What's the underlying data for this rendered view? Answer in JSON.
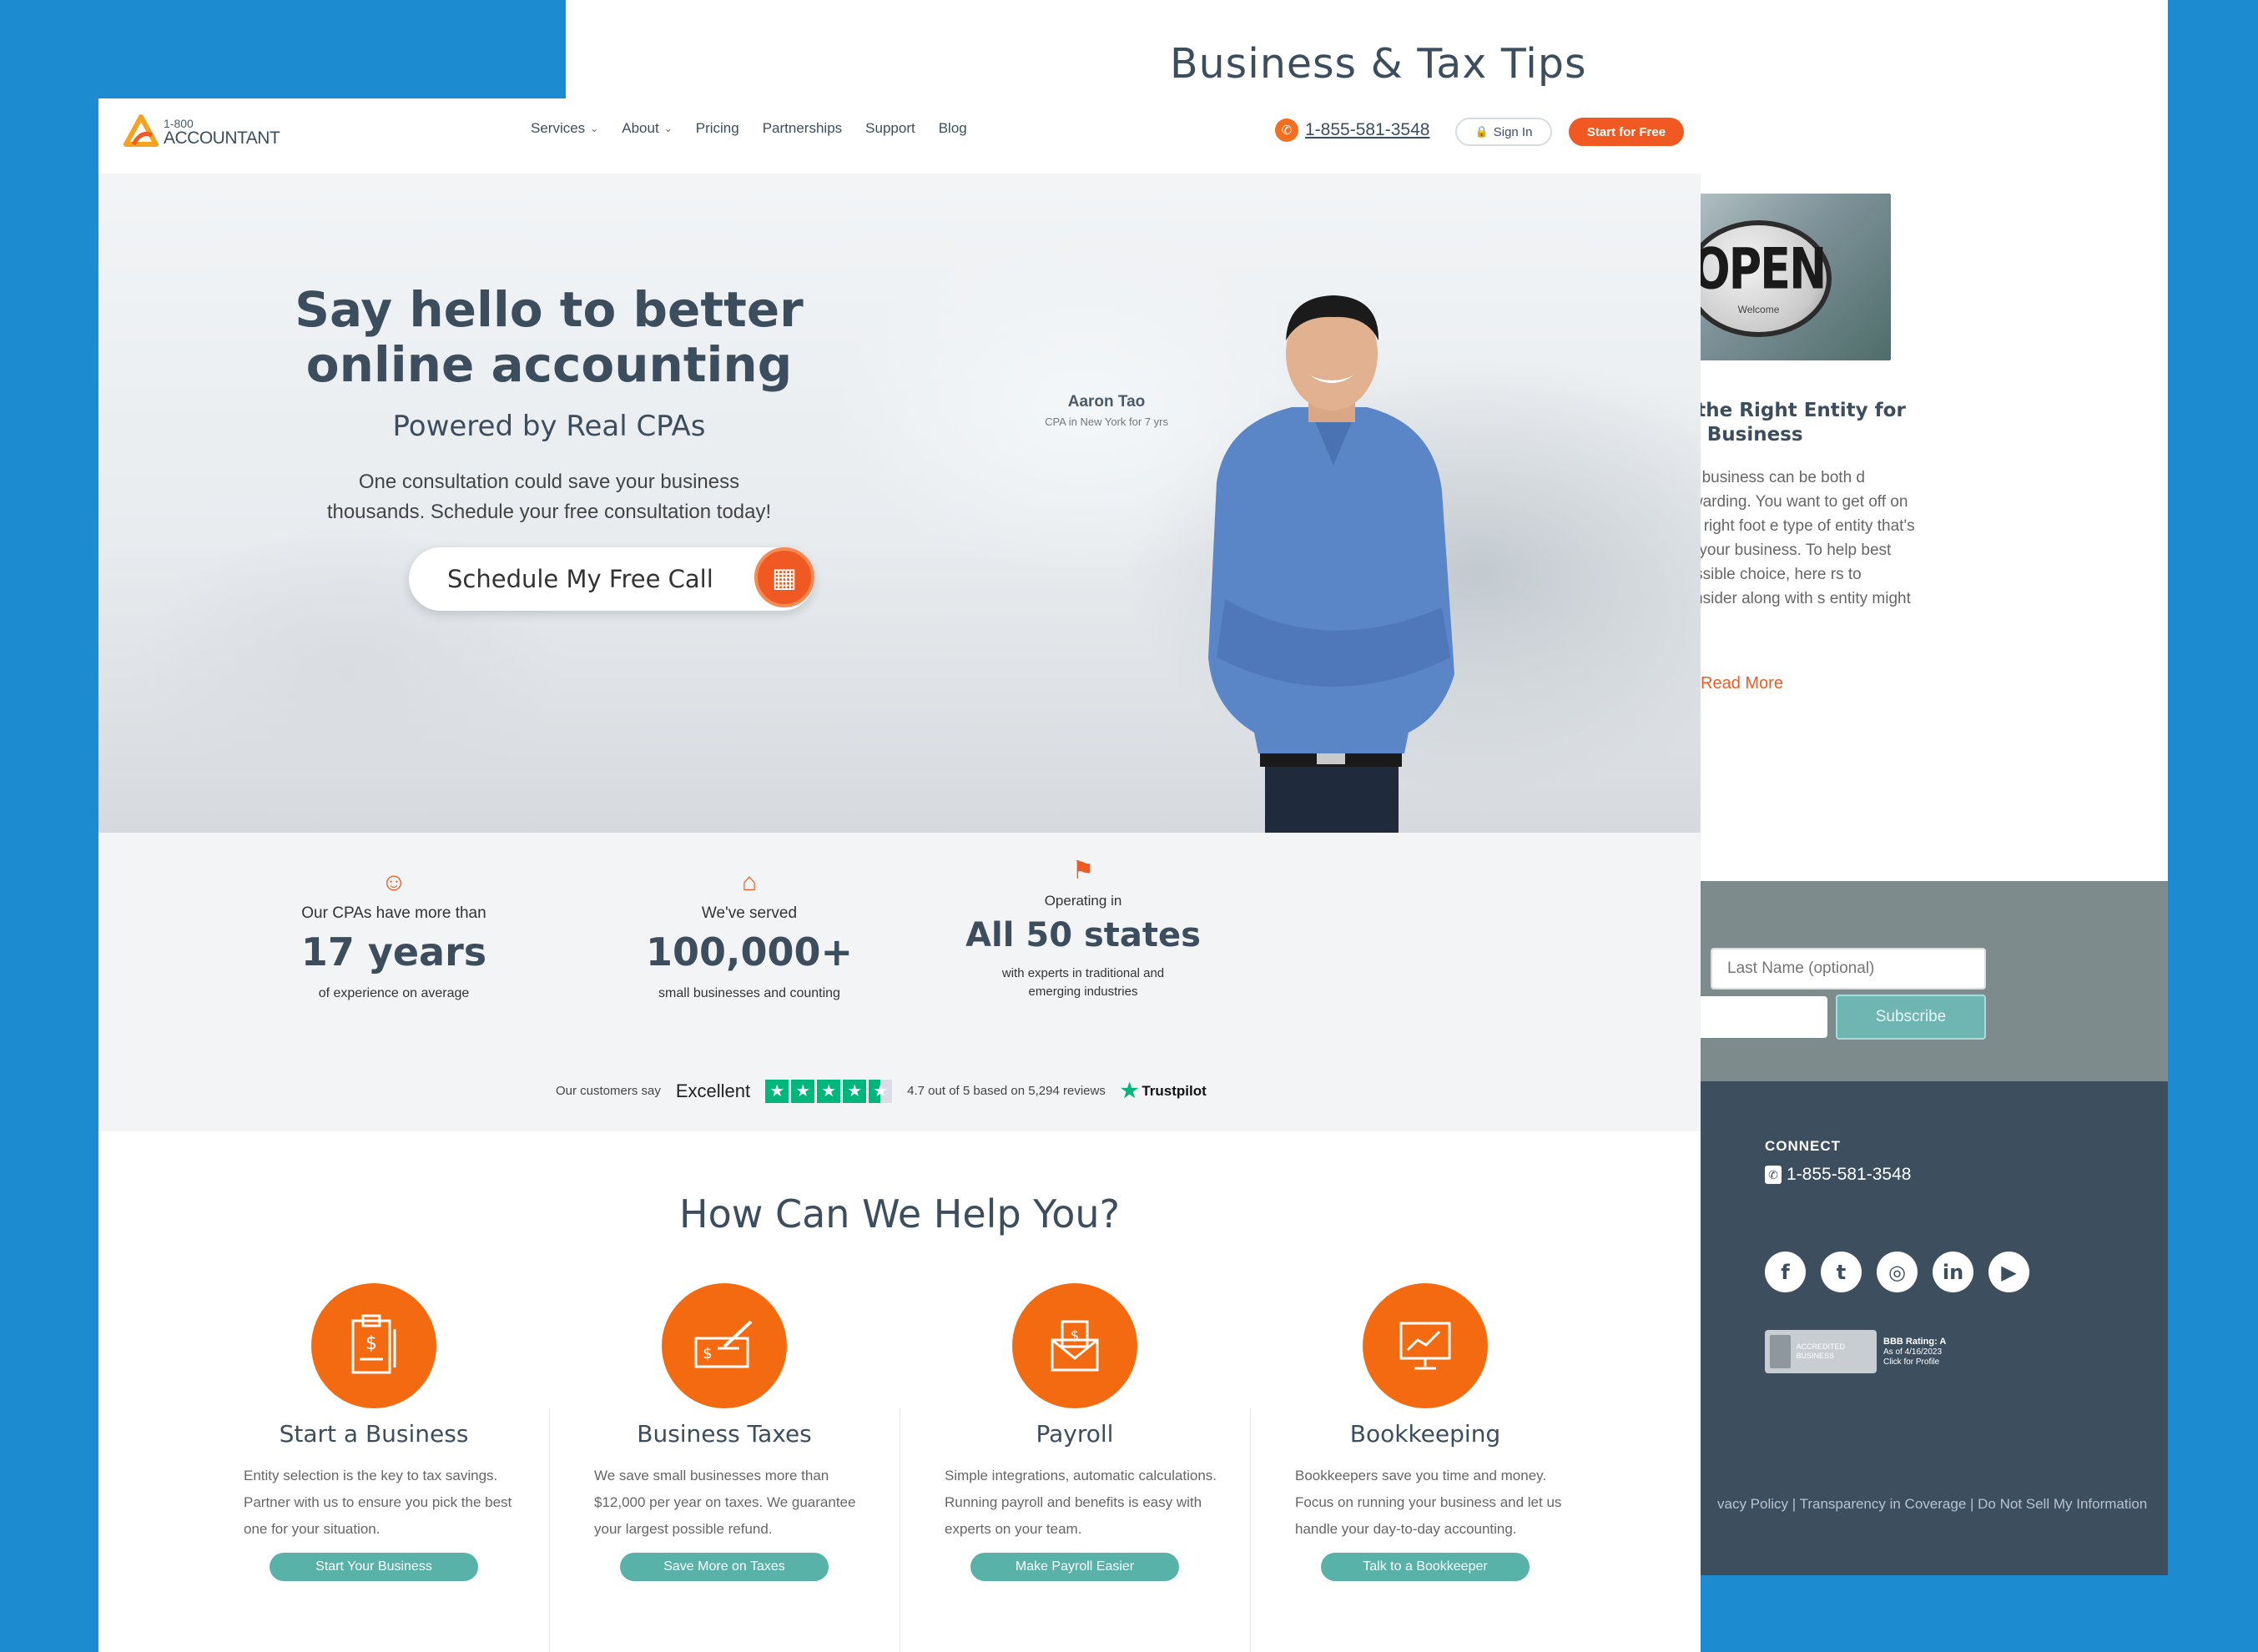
{
  "background_card": {
    "title": "Business & Tax Tips",
    "blog": {
      "image_sign_text": "OPEN",
      "image_sign_subtext": "Welcome",
      "title": "k the Right Entity for ur Business",
      "excerpt": "wn business can be both d rewarding. You want to get off on the right foot e type of entity that's nd your business. To help best possible choice, here rs to consider along with s entity might [...]",
      "read_more": "Read More"
    },
    "newsletter": {
      "last_name_placeholder": "Last Name (optional)",
      "subscribe_label": "Subscribe"
    },
    "footer": {
      "connect_label": "CONNECT",
      "phone": "1-855-581-3548",
      "social_icons": [
        "facebook-icon",
        "twitter-icon",
        "instagram-icon",
        "linkedin-icon",
        "youtube-icon"
      ],
      "social_glyphs": [
        "f",
        "t",
        "◎",
        "in",
        "▶"
      ],
      "bbb_seal": "ACCREDITED BUSINESS",
      "bbb_rating": "BBB Rating: A",
      "bbb_date": "As of 4/16/2023",
      "bbb_click": "Click for Profile",
      "links": "vacy Policy | Transparency in Coverage | Do Not Sell My Information"
    }
  },
  "nav": {
    "logo_top": "1-800",
    "logo_bottom": "ACCOUNTANT",
    "menu": [
      {
        "label": "Services",
        "has_dropdown": true
      },
      {
        "label": "About",
        "has_dropdown": true
      },
      {
        "label": "Pricing",
        "has_dropdown": false
      },
      {
        "label": "Partnerships",
        "has_dropdown": false
      },
      {
        "label": "Support",
        "has_dropdown": false
      },
      {
        "label": "Blog",
        "has_dropdown": false
      }
    ],
    "phone": "1-855-581-3548",
    "sign_in": "Sign In",
    "start_free": "Start for Free"
  },
  "hero": {
    "headline": "Say hello to better online accounting",
    "subheadline": "Powered by Real CPAs",
    "body": "One consultation could save your business thousands. Schedule your free consultation today!",
    "cta": "Schedule My Free Call",
    "person_name": "Aaron Tao",
    "person_role": "CPA in New York for 7 yrs"
  },
  "stats": [
    {
      "icon": "face-icon",
      "lead": "Our CPAs have more than",
      "big": "17 years",
      "tail": "of experience on average"
    },
    {
      "icon": "storefront-icon",
      "lead": "We've served",
      "big": "100,000+",
      "tail": "small businesses and counting"
    },
    {
      "icon": "flag-icon",
      "lead": "Operating in",
      "big": "All 50 states",
      "tail": "with experts in traditional and emerging industries"
    }
  ],
  "trustpilot": {
    "say": "Our customers say",
    "rating_word": "Excellent",
    "stars": 4.5,
    "summary": "4.7 out of 5 based on 5,294 reviews",
    "brand": "Trustpilot"
  },
  "help": {
    "title": "How Can We Help You?",
    "services": [
      {
        "icon": "clipboard-icon",
        "title": "Start a Business",
        "text": "Entity selection is the key to tax savings. Partner with us to ensure you pick the best one for your situation.",
        "button": "Start Your Business"
      },
      {
        "icon": "check-signing-icon",
        "title": "Business Taxes",
        "text": "We save small businesses more than $12,000 per year on taxes. We guarantee your largest possible refund.",
        "button": "Save More on Taxes"
      },
      {
        "icon": "envelope-icon",
        "title": "Payroll",
        "text": "Simple integrations, automatic calculations. Running payroll and benefits is easy with experts on your team.",
        "button": "Make Payroll Easier"
      },
      {
        "icon": "chart-board-icon",
        "title": "Bookkeeping",
        "text": "Bookkeepers save you time and money. Focus on running your business and let us handle your day-to-day accounting.",
        "button": "Talk to a Bookkeeper"
      }
    ]
  },
  "colors": {
    "accent": "#f05a22",
    "navy": "#3c4e5e",
    "teal": "#59b2a7",
    "page_bg": "#1d8bd0"
  }
}
